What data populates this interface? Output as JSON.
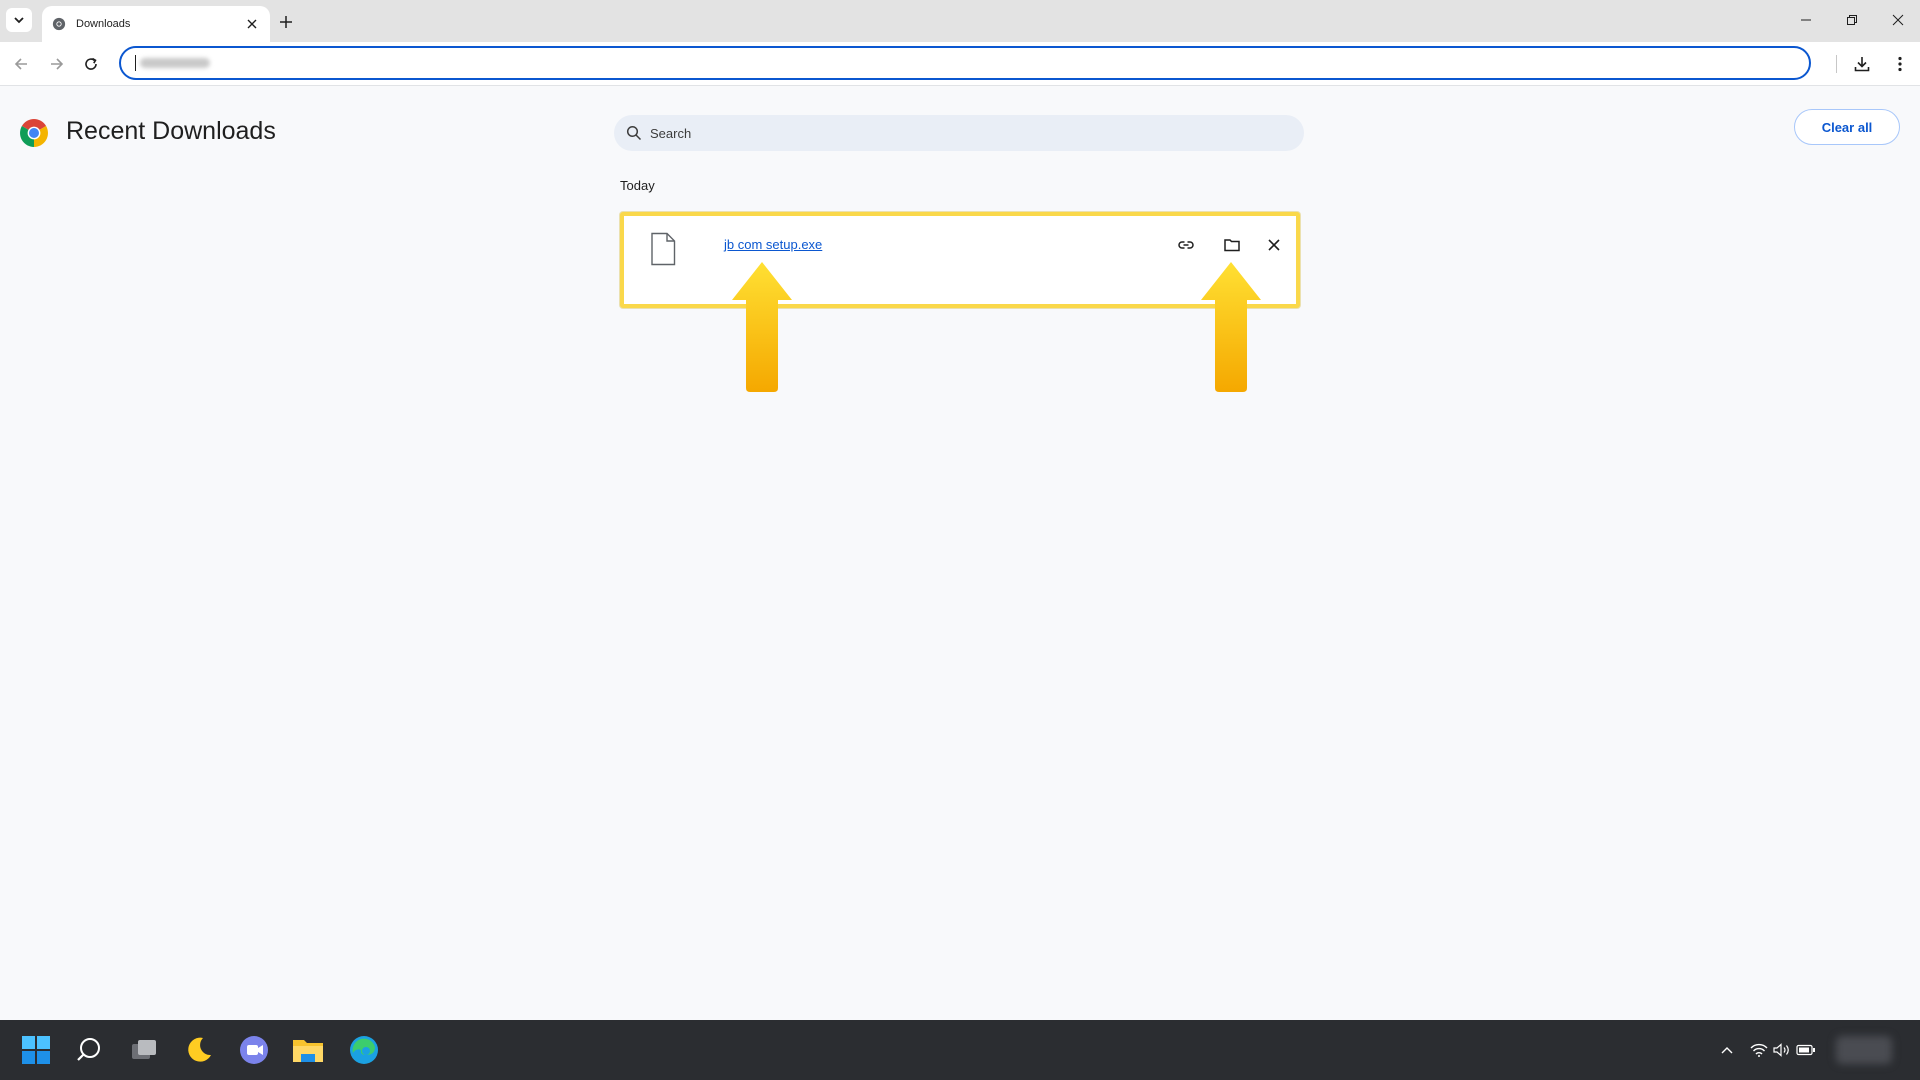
{
  "browser": {
    "tab_title": "Downloads"
  },
  "page": {
    "title": "Recent Downloads",
    "search_placeholder": "Search",
    "clear_all_label": "Clear all",
    "date_heading": "Today"
  },
  "downloads": [
    {
      "file_name": "jb com setup.exe"
    }
  ],
  "colors": {
    "accent": "#0b57d0",
    "highlight_border": "#fad84a",
    "arrow_top": "#ffe033",
    "arrow_bottom": "#f5a800",
    "taskbar": "#2b2d31"
  }
}
